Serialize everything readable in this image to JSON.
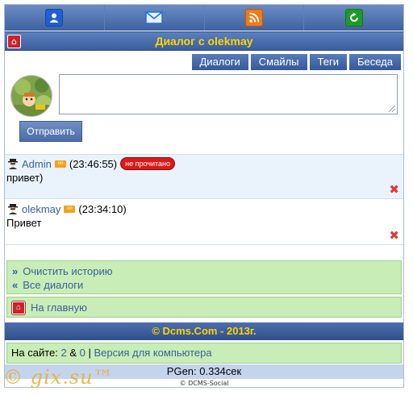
{
  "topbar": {
    "items": [
      {
        "icon": "user-icon",
        "color": "#1f5fd0"
      },
      {
        "icon": "mail-icon",
        "color": "#1f6fe0"
      },
      {
        "icon": "rss-icon",
        "color": "#f07a16"
      },
      {
        "icon": "refresh-icon",
        "color": "#1e9a2a"
      }
    ]
  },
  "header": {
    "title": "Диалог с olekmay"
  },
  "tabs": [
    "Диалоги",
    "Смайлы",
    "Теги",
    "Беседа"
  ],
  "composer": {
    "send_label": "Отправить",
    "message_value": ""
  },
  "messages": [
    {
      "user": "Admin",
      "status": "on",
      "time": "(23:46:55)",
      "badge": "не прочитано",
      "text": "привет)"
    },
    {
      "user": "olekmay",
      "status": "on",
      "time": "(23:34:10)",
      "badge": "",
      "text": "Привет"
    }
  ],
  "links": {
    "clear_history": "Очистить историю",
    "all_dialogs": "Все диалоги",
    "home": "На главную"
  },
  "footer": {
    "copyright": "© Dcms.Com - 2013г.",
    "online_prefix": "На сайте: ",
    "online_a": "2",
    "online_sep": " & ",
    "online_b": "0",
    "divider": " | ",
    "desktop_link": "Версия для компьютера",
    "pgen": "PGen: 0.334сек",
    "social": "© DCMS-Social"
  },
  "watermark": "© gix.su™",
  "colors": {
    "accent": "#3b5d9c",
    "title": "#ffd200",
    "green": "#c8edb6",
    "unread": "#d81a1a"
  }
}
